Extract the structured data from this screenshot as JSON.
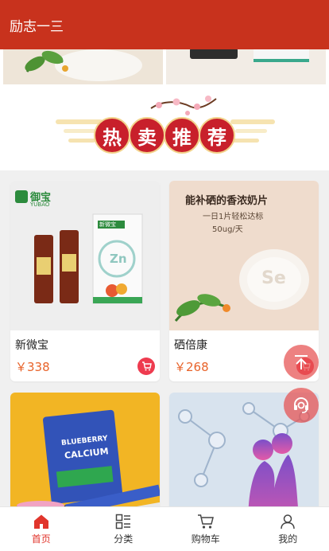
{
  "header": {
    "title": "励志一三"
  },
  "banner": {
    "title_chars": [
      "热",
      "卖",
      "推",
      "荐"
    ]
  },
  "products": [
    {
      "name": "新微宝",
      "price": "￥338",
      "image": {
        "brand_cn": "御宝",
        "brand_en": "YUBAO",
        "box_label": "新微宝",
        "box_mark": "Zn"
      }
    },
    {
      "name": "硒倍康",
      "price": "￥268",
      "image": {
        "headline": "能补硒的香浓奶片",
        "line1": "一日1片轻松达标",
        "line2": "50ug/天",
        "tablet_mark": "Se"
      }
    },
    {
      "name": "",
      "price": "",
      "image": {
        "box_line1": "BLUEBERRY",
        "box_line2": "CALCIUM"
      }
    },
    {
      "name": "",
      "price": "",
      "image": {}
    }
  ],
  "tabbar": {
    "items": [
      {
        "label": "首页",
        "icon": "home-icon",
        "active": true
      },
      {
        "label": "分类",
        "icon": "category-icon",
        "active": false
      },
      {
        "label": "购物车",
        "icon": "cart-icon",
        "active": false
      },
      {
        "label": "我的",
        "icon": "user-icon",
        "active": false
      }
    ]
  },
  "colors": {
    "header": "#c8321d",
    "accent": "#e1352c",
    "price": "#e8632a",
    "cart_button": "#ee3b4f"
  }
}
